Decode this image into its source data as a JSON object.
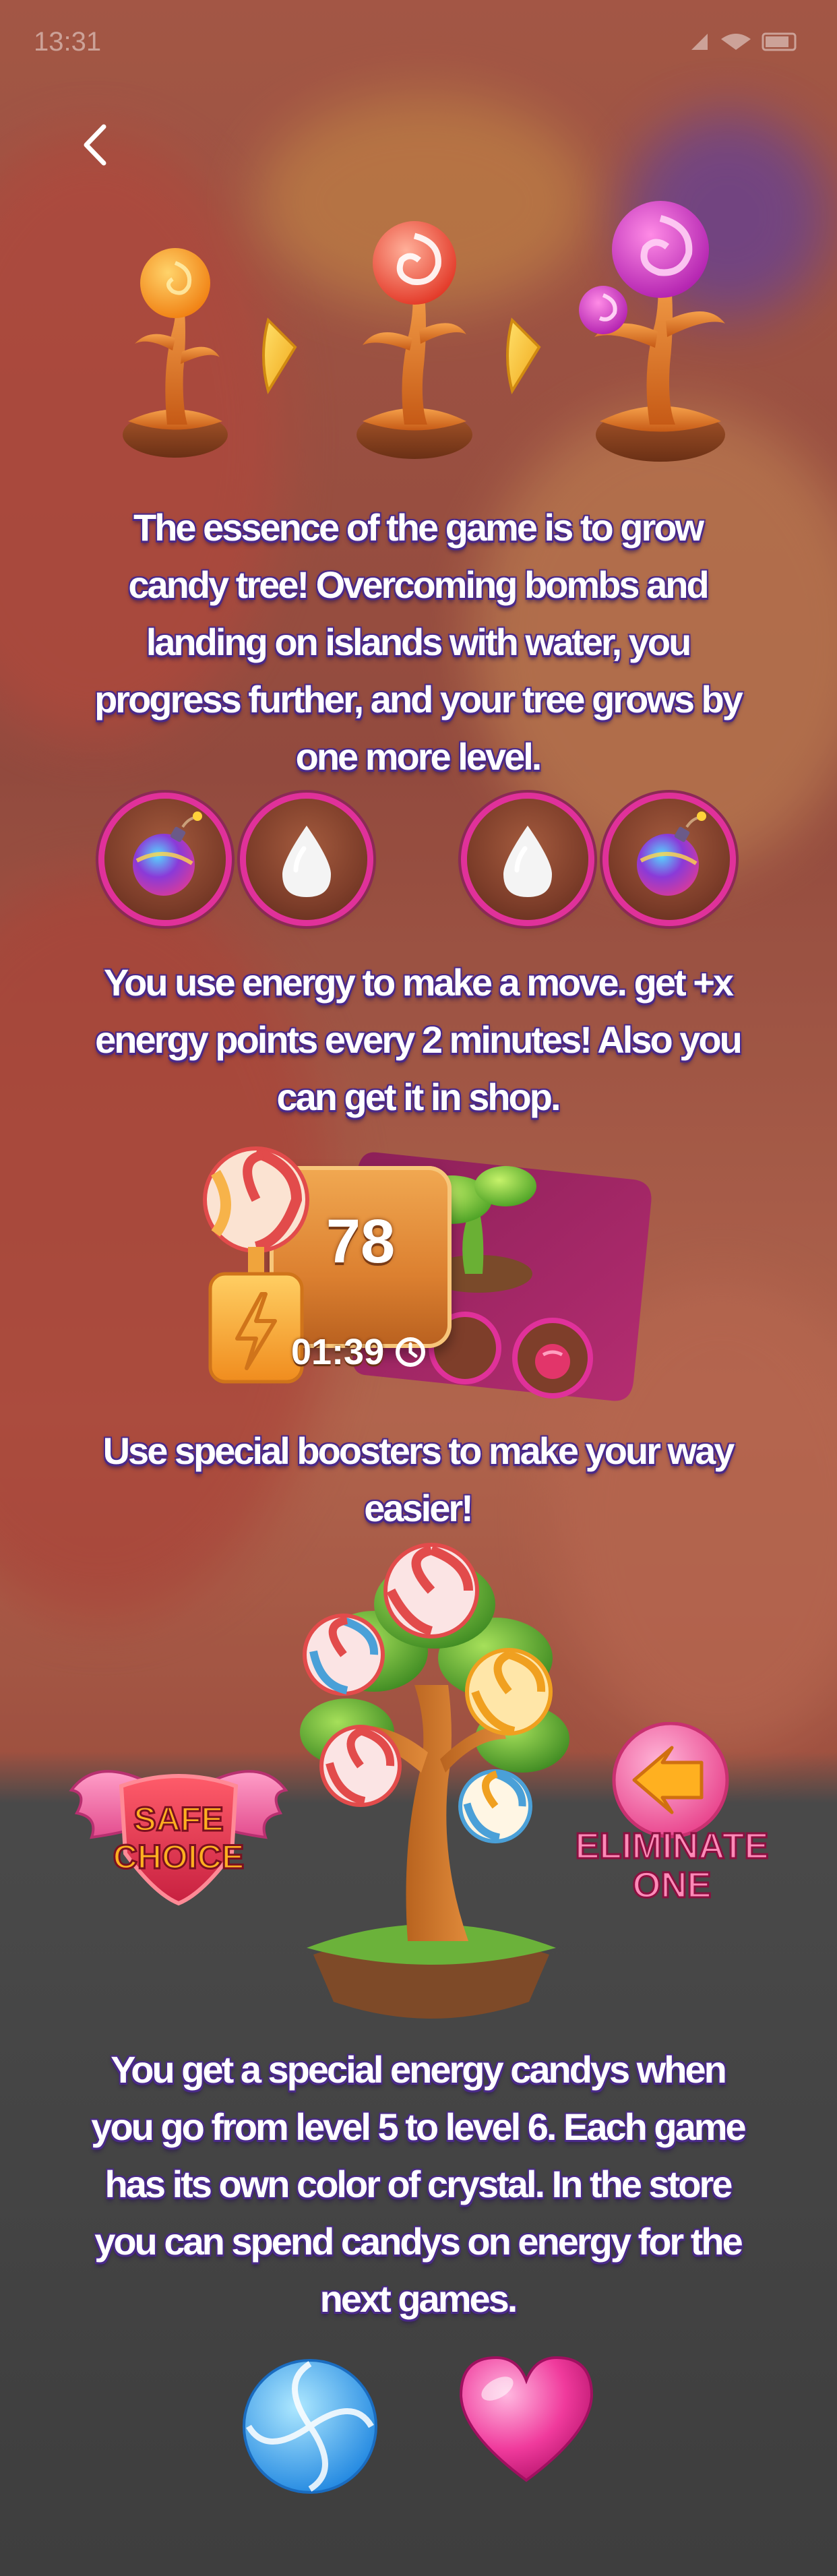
{
  "status_bar": {
    "time": "13:31",
    "icons": "signal-icon wifi-icon battery-icon"
  },
  "back": {
    "icon": "chevron-left-icon"
  },
  "sections": [
    {
      "text": "The essence of the game is to grow candy tree! Overcoming bombs and landing on islands with water, you progress further, and your tree grows by one more level."
    },
    {
      "text": "You use energy to make a move. get +x energy points every 2 minutes! Also you can get it in shop."
    },
    {
      "text": "Use special boosters to make your way easier!"
    },
    {
      "text": "You get a special energy candys when you go from level 5 to level 6. Each game has its own color of crystal. In the store you can spend candys on energy for the next games."
    }
  ],
  "energy": {
    "count": "78",
    "timer": "01:39"
  },
  "boosters": {
    "safe_line1": "SAFE",
    "safe_line2": "CHOICE",
    "eliminate_line1": "ELIMINATE",
    "eliminate_line2": "ONE"
  },
  "colors": {
    "accent": "#e0319a",
    "text_outline": "#4a2a8a",
    "caramel": "#e07a2a"
  }
}
